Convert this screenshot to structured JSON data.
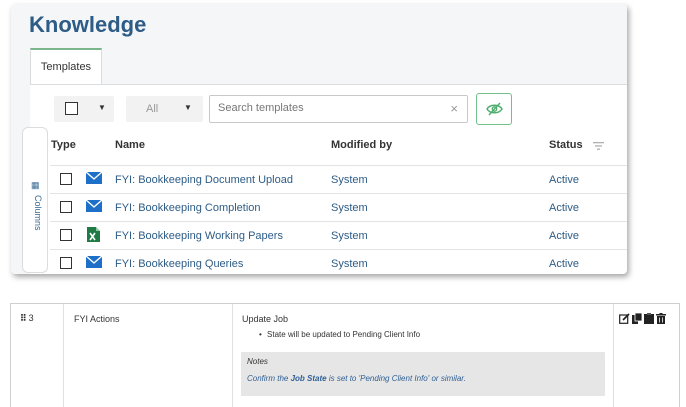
{
  "header": {
    "title": "Knowledge"
  },
  "tabs": [
    {
      "label": "Templates"
    }
  ],
  "toolbar": {
    "filter_value": "All",
    "search_placeholder": "Search templates",
    "clear_glyph": "×"
  },
  "columns_panel": {
    "label": "Columns"
  },
  "table": {
    "headers": {
      "type": "Type",
      "name": "Name",
      "modified_by": "Modified by",
      "status": "Status"
    },
    "rows": [
      {
        "type_icon": "envelope-icon",
        "name": "FYI: Bookkeeping Document Upload",
        "modified_by": "System",
        "status": "Active"
      },
      {
        "type_icon": "envelope-icon",
        "name": "FYI: Bookkeeping Completion",
        "modified_by": "System",
        "status": "Active"
      },
      {
        "type_icon": "excel-icon",
        "name": "FYI: Bookkeeping Working Papers",
        "modified_by": "System",
        "status": "Active"
      },
      {
        "type_icon": "envelope-icon",
        "name": "FYI: Bookkeeping Queries",
        "modified_by": "System",
        "status": "Active"
      }
    ]
  },
  "workflow_step": {
    "number": "3",
    "category": "FYI Actions",
    "action_title": "Update Job",
    "action_detail": "State will be updated to Pending Client Info",
    "notes_title": "Notes",
    "notes_prefix": "Confirm the ",
    "notes_emphasis": "Job State",
    "notes_suffix": " is set to 'Pending Client Info' or similar."
  },
  "colors": {
    "title_blue": "#2d5c86",
    "accent_green": "#72c08b",
    "link_blue": "#2f5f95"
  }
}
